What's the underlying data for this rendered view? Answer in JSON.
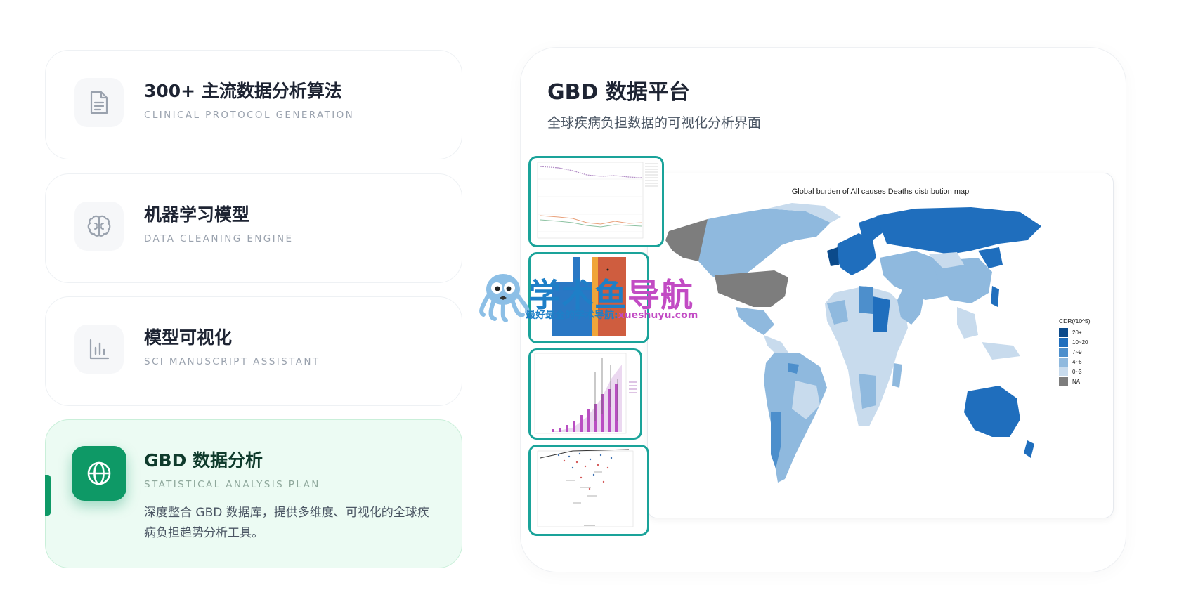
{
  "features": [
    {
      "title": "300+ 主流数据分析算法",
      "subtitle": "CLINICAL PROTOCOL GENERATION",
      "icon": "document-icon"
    },
    {
      "title": "机器学习模型",
      "subtitle": "DATA CLEANING ENGINE",
      "icon": "brain-icon"
    },
    {
      "title": "模型可视化",
      "subtitle": "SCI MANUSCRIPT ASSISTANT",
      "icon": "bar-chart-icon"
    },
    {
      "title": "GBD 数据分析",
      "subtitle": "STATISTICAL ANALYSIS PLAN",
      "icon": "globe-icon",
      "description": "深度整合 GBD 数据库，提供多维度、可视化的全球疾病负担趋势分析工具。"
    }
  ],
  "panel": {
    "title": "GBD 数据平台",
    "subtitle": "全球疾病负担数据的可视化分析界面"
  },
  "map": {
    "title": "Global burden of All causes Deaths distribution map",
    "legend_title": "CDR(/10^5)",
    "legend": [
      {
        "label": "20+",
        "color": "#0b4a8b"
      },
      {
        "label": "10~20",
        "color": "#1f6ebd"
      },
      {
        "label": "7~9",
        "color": "#4d8fcc"
      },
      {
        "label": "4~6",
        "color": "#8fb9de"
      },
      {
        "label": "0~3",
        "color": "#c8dbed"
      },
      {
        "label": "NA",
        "color": "#7d7d7d"
      }
    ]
  },
  "watermark": {
    "name_blue": "学术鱼",
    "name_pink": "导航",
    "tagline_blue": "最好最全的学术导航:",
    "tagline_pink": "xueshuyu.com"
  },
  "colors": {
    "accent": "#0e9966",
    "thumb_border": "#1aa39a"
  }
}
